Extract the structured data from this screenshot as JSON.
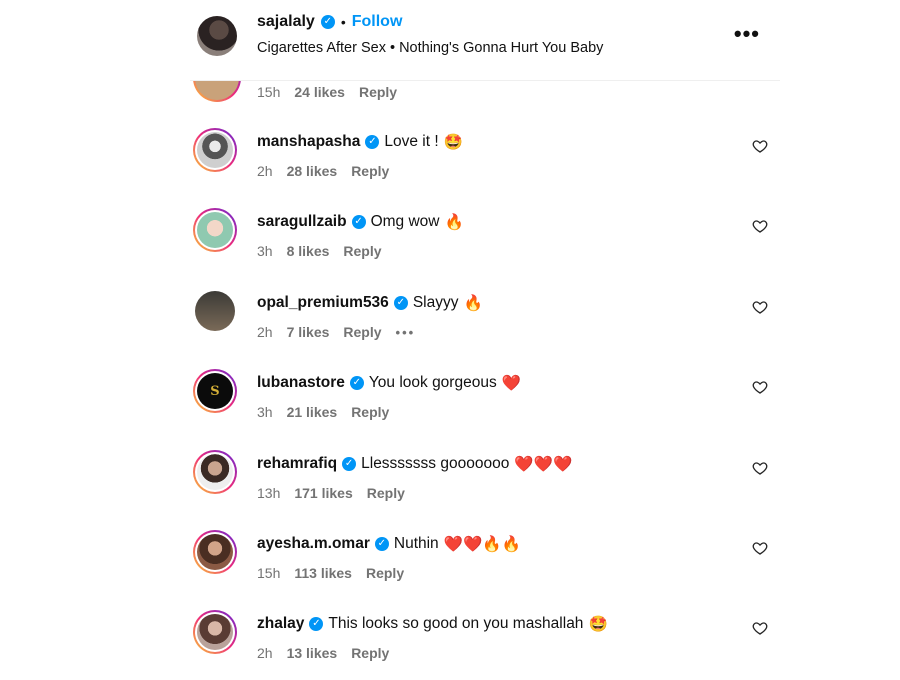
{
  "header": {
    "username": "sajalaly",
    "separator": "•",
    "follow_label": "Follow",
    "audio": "Cigarettes After Sex • Nothing's Gonna Hurt You Baby",
    "more_label": "•••"
  },
  "partial_comment": {
    "time": "15h",
    "likes": "24 likes",
    "reply": "Reply"
  },
  "comments": [
    {
      "username": "manshapasha",
      "text": "Love it !",
      "emoji": "🤩",
      "time": "2h",
      "likes": "28 likes",
      "reply": "Reply"
    },
    {
      "username": "saragullzaib",
      "text": "Omg wow",
      "emoji": "🔥",
      "time": "3h",
      "likes": "8 likes",
      "reply": "Reply"
    },
    {
      "username": "opal_premium536",
      "text": "Slayyy",
      "emoji": "🔥",
      "time": "2h",
      "likes": "7 likes",
      "reply": "Reply",
      "more": "•••"
    },
    {
      "username": "lubanastore",
      "text": "You look gorgeous",
      "emoji": "❤️",
      "time": "3h",
      "likes": "21 likes",
      "reply": "Reply",
      "avatar_text": "S"
    },
    {
      "username": "rehamrafiq",
      "text": "Llesssssss gooooooo",
      "emoji": "❤️❤️❤️",
      "time": "13h",
      "likes": "171 likes",
      "reply": "Reply"
    },
    {
      "username": "ayesha.m.omar",
      "text": "Nuthin",
      "emoji": "❤️❤️🔥🔥",
      "time": "15h",
      "likes": "113 likes",
      "reply": "Reply"
    },
    {
      "username": "zhalay",
      "text": "This looks so good on you mashallah",
      "emoji": "🤩",
      "time": "2h",
      "likes": "13 likes",
      "reply": "Reply"
    }
  ],
  "colors": {
    "accent": "#0095f6",
    "verified": "#0095f6",
    "muted": "#737373"
  }
}
